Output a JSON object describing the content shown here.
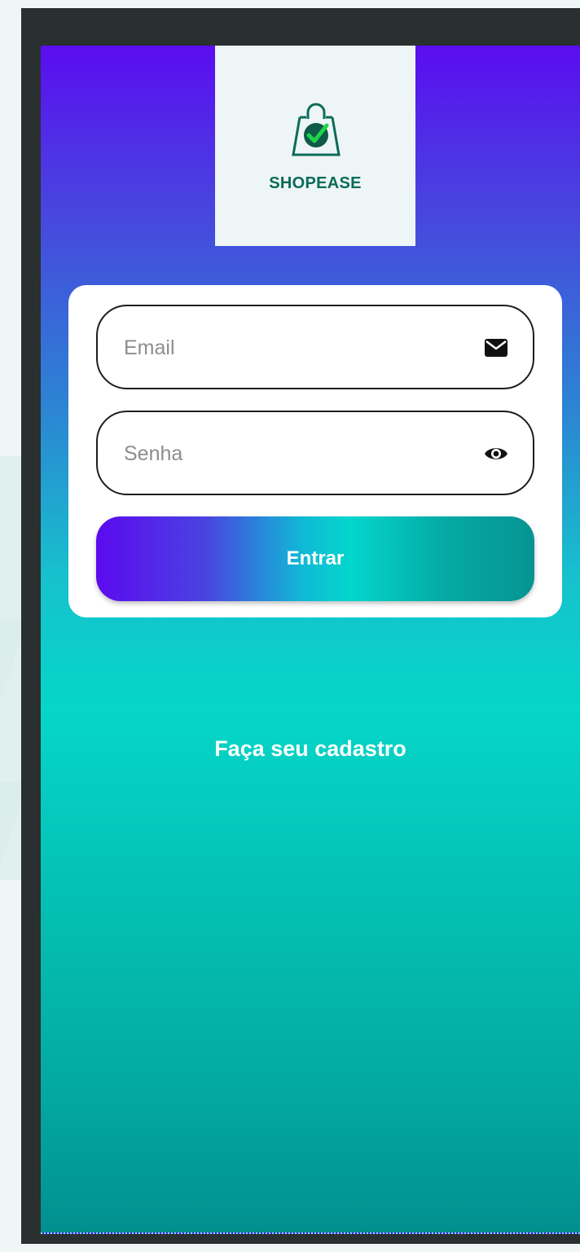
{
  "app": {
    "brand_name": "SHOPEASE",
    "logo_icon": "shopping-bag-check-icon"
  },
  "login_form": {
    "email_placeholder": "Email",
    "email_value": "",
    "email_icon": "envelope-icon",
    "password_placeholder": "Senha",
    "password_value": "",
    "password_icon": "eye-icon",
    "submit_label": "Entrar"
  },
  "signup": {
    "link_label": "Faça seu cadastro"
  },
  "colors": {
    "gradient_top": "#5a0df0",
    "gradient_mid": "#05d6c8",
    "gradient_bottom": "#02908f",
    "brand_green": "#0b6b58",
    "check_green": "#1fd34a"
  }
}
